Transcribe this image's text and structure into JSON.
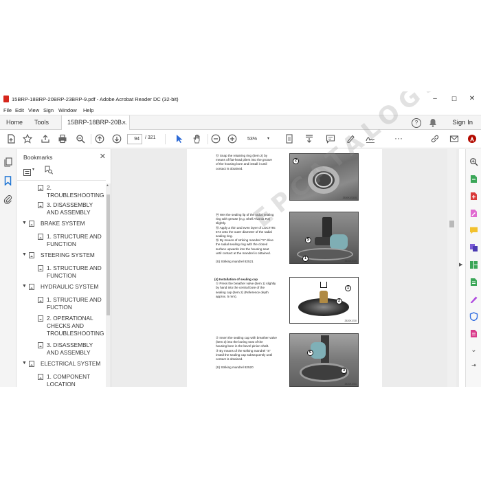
{
  "window": {
    "title": "15BRP-18BRP-20BRP-23BRP-9.pdf - Adobe Acrobat Reader DC (32-bit)",
    "controls": [
      "–",
      "☐",
      "✕"
    ]
  },
  "menu": [
    "File",
    "Edit",
    "View",
    "Sign",
    "Window",
    "Help"
  ],
  "tabs": {
    "home": "Home",
    "tools": "Tools",
    "document": "15BRP-18BRP-20B...",
    "close_glyph": "×",
    "help_glyph": "?",
    "sign_in": "Sign In"
  },
  "toolbar": {
    "page_current": "94",
    "page_total": "/ 321",
    "zoom": "53%",
    "more": "···"
  },
  "bookmarks": {
    "title": "Bookmarks",
    "close_glyph": "✕",
    "items": [
      {
        "text": "2.",
        "level": 2
      },
      {
        "text": "TROUBLESHOOTING",
        "level": 2
      },
      {
        "text": "3. DISASSEMBLY",
        "level": 2
      },
      {
        "text": "AND ASSEMBLY",
        "level": 2
      },
      {
        "text": "BRAKE SYSTEM",
        "level": 1
      },
      {
        "text": "1. STRUCTURE AND",
        "level": 2
      },
      {
        "text": "FUNCTION",
        "level": 2
      },
      {
        "text": "STEERING SYSTEM",
        "level": 1
      },
      {
        "text": "1. STRUCTURE AND",
        "level": 2
      },
      {
        "text": "FUNCTION",
        "level": 2
      },
      {
        "text": "HYDRAULIC SYSTEM",
        "level": 1
      },
      {
        "text": "1. STRUCTURE AND",
        "level": 2
      },
      {
        "text": "FUCTION",
        "level": 2
      },
      {
        "text": "2. OPERATIONAL",
        "level": 2
      },
      {
        "text": "CHECKS AND",
        "level": 2
      },
      {
        "text": "TROUBLESHOOTING",
        "level": 2
      },
      {
        "text": "3. DISASSEMBLY",
        "level": 2
      },
      {
        "text": "AND ASSEMBLY",
        "level": 2
      },
      {
        "text": "ELECTRICAL SYSTEM",
        "level": 1
      },
      {
        "text": "1. COMPONENT",
        "level": 2
      },
      {
        "text": "LOCATION",
        "level": 2
      }
    ]
  },
  "page": {
    "s1": [
      "⑬ Snap the retaining ring (item 2) by",
      "means of flat-head pliers into the groove",
      "of the housing bore and install it until",
      "contact is obtained."
    ],
    "s2": [
      "⑭ Wet the sealing lip of the radial sealing",
      "ring with grease (e.g. Shell Alvania R3)",
      "slightly.",
      "⑮ Apply a thin and even layer of LOCTITE",
      "574 onto the outer diameter of the radial",
      "sealing ring.",
      "⑯ By means of striking mandrel \"S\" drive",
      "the radial sealing ring with the closed",
      "surface upwards into the housing seat",
      "until contact at the mandrel is obtained.",
      "",
      "(S) Striking mandrel 82521"
    ],
    "s3_head": "(4) Installation of sealing cap",
    "s3": [
      "① Press the breather valve (item 1) slightly",
      "by hand into the central bore of the",
      "sealing cap (item 2) (Reference depth",
      "approx. 5 mm)."
    ],
    "s4": [
      "② Insert the sealing cap with breather valve",
      "(item 3) into the boring seat of the",
      "housing bore in the bevel pinion shaft.",
      "③ By means of the striking mandrel \"S\"",
      "install the sealing cap subsequently until",
      "contact is obtained.",
      "",
      "(S) Striking mandrel 82520"
    ],
    "callouts": {
      "p1_a": "2",
      "p2_a": "S",
      "p2_b": "1",
      "p3_a": "1",
      "p3_b": "2",
      "p4_a": "S",
      "p4_b": "3"
    },
    "fig_codes": {
      "f1": "2520K-E28.5",
      "f2": "2520K-E29",
      "f3": "2520K-E30",
      "f4": "2520K-E31"
    }
  },
  "watermark": "EPCATALOGS.COM"
}
